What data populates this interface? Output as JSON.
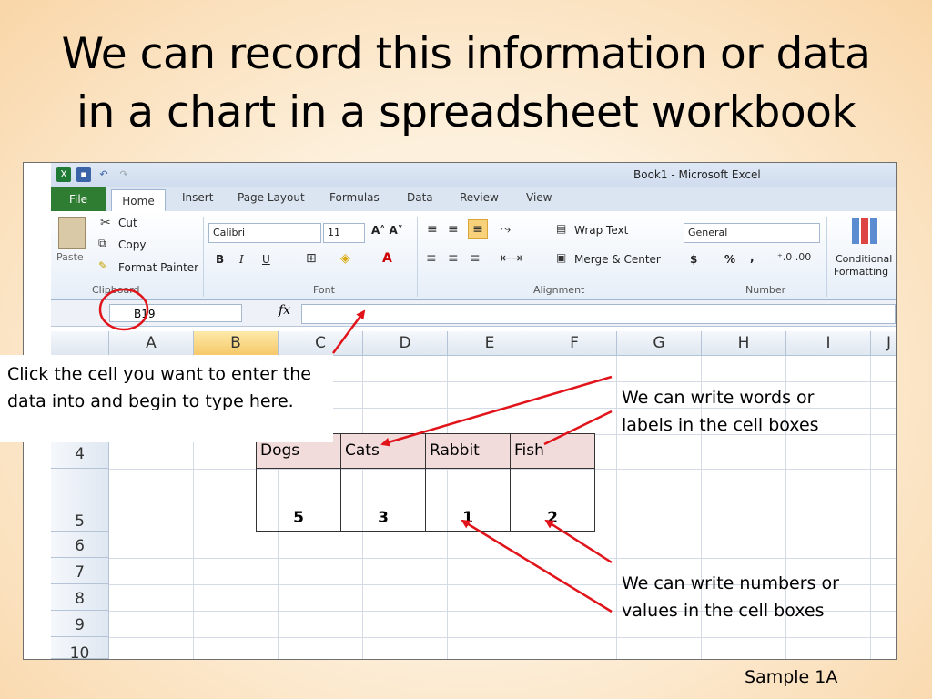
{
  "slide": {
    "title_line1": "We can record this information or  data",
    "title_line2": "in a chart in a spreadsheet workbook",
    "footer": "Sample 1A"
  },
  "excel": {
    "window_title": "Book1  -  Microsoft Excel",
    "tabs": [
      "File",
      "Home",
      "Insert",
      "Page Layout",
      "Formulas",
      "Data",
      "Review",
      "View"
    ],
    "clipboard": {
      "paste": "Paste",
      "cut": "Cut",
      "copy": "Copy",
      "format_painter": "Format Painter",
      "group_label": "Clipboard"
    },
    "font": {
      "name": "Calibri",
      "size": "11",
      "group_label": "Font",
      "bold": "B",
      "italic": "I",
      "underline": "U"
    },
    "alignment": {
      "wrap_text": "Wrap Text",
      "merge_center": "Merge & Center",
      "group_label": "Alignment"
    },
    "number": {
      "format": "General",
      "currency": "$",
      "percent": "%",
      "comma": ",",
      "group_label": "Number"
    },
    "styles": {
      "conditional": "Conditional",
      "formatting": "Formatting"
    },
    "name_box": "B19",
    "fx": "fx",
    "columns": [
      "A",
      "B",
      "C",
      "D",
      "E",
      "F",
      "G",
      "H",
      "I",
      "J"
    ],
    "rows": [
      "4",
      "5",
      "6",
      "7",
      "8",
      "9",
      "10"
    ],
    "labels": [
      "Dogs",
      "Cats",
      "Rabbit",
      "Fish"
    ],
    "values": [
      "5",
      "3",
      "1",
      "2"
    ]
  },
  "callouts": {
    "enter_data": "Click the cell you want to enter the data into and begin to type here.",
    "words_labels": "We can write words or labels in the cell boxes",
    "numbers_values": "We can write numbers or values in the cell boxes"
  },
  "colors": {
    "arrow": "#e0141a",
    "header_fill": "#f2dcdb",
    "file_tab": "#2f7d32"
  }
}
